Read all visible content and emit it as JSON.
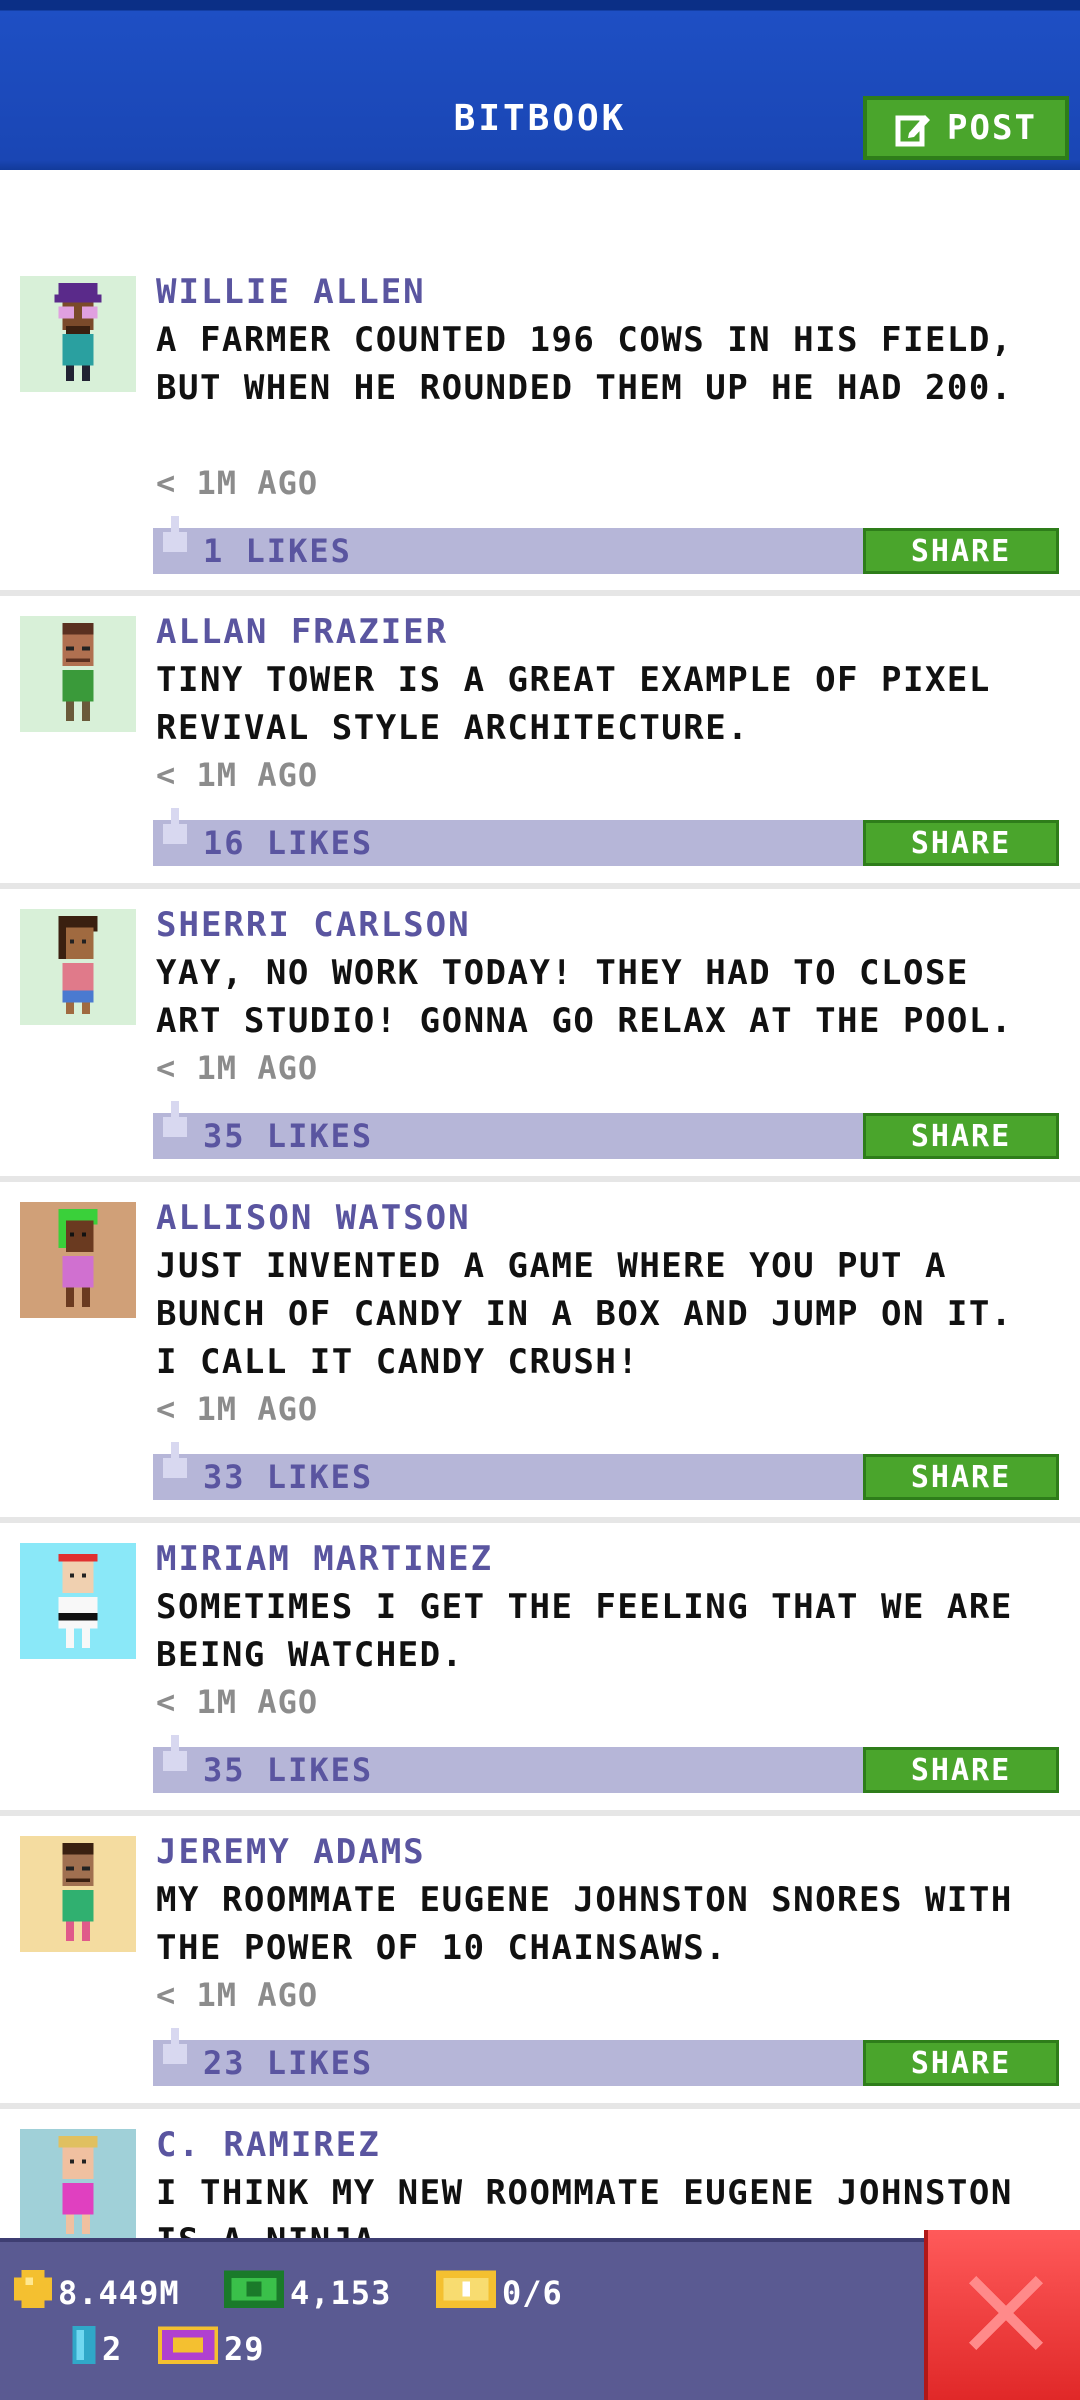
{
  "header": {
    "title": "BITBOOK",
    "post_label": "POST"
  },
  "posts": [
    {
      "name": "WILLIE ALLEN",
      "message": "A FARMER COUNTED 196 COWS IN HIS FIELD, BUT WHEN HE ROUNDED THEM UP HE HAD 200.",
      "time": "< 1M AGO",
      "likes": "1 LIKES",
      "share": "SHARE"
    },
    {
      "name": "ALLAN FRAZIER",
      "message": "TINY TOWER IS A GREAT EXAMPLE OF PIXEL REVIVAL STYLE ARCHITECTURE.",
      "time": "< 1M AGO",
      "likes": "16 LIKES",
      "share": "SHARE"
    },
    {
      "name": "SHERRI CARLSON",
      "message": "YAY, NO WORK TODAY! THEY HAD TO CLOSE ART STUDIO! GONNA GO RELAX AT THE POOL.",
      "time": "< 1M AGO",
      "likes": "35 LIKES",
      "share": "SHARE"
    },
    {
      "name": "ALLISON WATSON",
      "message": "JUST INVENTED A GAME WHERE YOU PUT A BUNCH OF CANDY IN A BOX AND JUMP ON IT. I CALL IT CANDY CRUSH!",
      "time": "< 1M AGO",
      "likes": "33 LIKES",
      "share": "SHARE"
    },
    {
      "name": "MIRIAM MARTINEZ",
      "message": "SOMETIMES I GET THE FEELING THAT WE ARE BEING WATCHED.",
      "time": "< 1M AGO",
      "likes": "35 LIKES",
      "share": "SHARE"
    },
    {
      "name": "JEREMY ADAMS",
      "message": "MY ROOMMATE EUGENE JOHNSTON SNORES WITH THE POWER OF 10 CHAINSAWS.",
      "time": "< 1M AGO",
      "likes": "23 LIKES",
      "share": "SHARE"
    },
    {
      "name": "C. RAMIREZ",
      "message": "I THINK MY NEW ROOMMATE EUGENE JOHNSTON IS A NINJA.",
      "time": "",
      "likes": "",
      "share": ""
    }
  ],
  "status_bar": {
    "coins": "8.449M",
    "bux": "4,153",
    "tickets": "0/6",
    "keys": "2",
    "vip": "29"
  },
  "colors": {
    "header_blue": "#1a46b4",
    "share_green": "#4aa52c",
    "like_bar": "#b6b6d8",
    "name_purple": "#5a55a0",
    "close_red": "#e02828"
  }
}
